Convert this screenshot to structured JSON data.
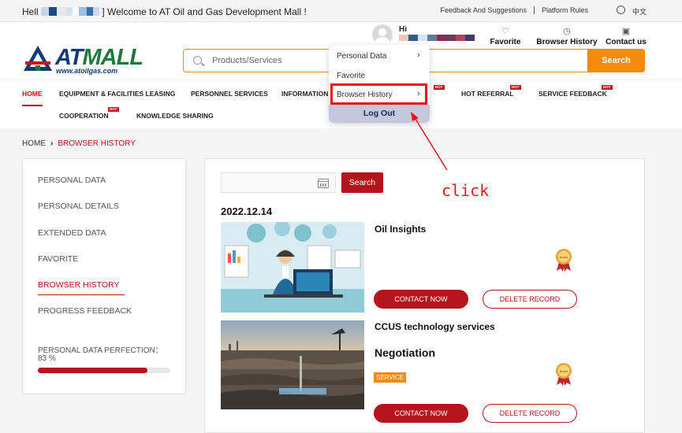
{
  "topbar": {
    "greeting_prefix": "Hell",
    "greeting_suffix": "] Welcome to AT Oil and Gas Development Mall !",
    "links": [
      "Feedback And Suggestions",
      "Platform Rules"
    ],
    "language": "中文"
  },
  "header": {
    "logo_text": "ATMALL",
    "logo_url": "www.atoilgas.com",
    "search_placeholder": "Products/Services",
    "search_button": "Search",
    "user_greeting": "Hi",
    "actions": [
      {
        "label": "Favorite",
        "icon": "heart-icon"
      },
      {
        "label": "Browser History",
        "icon": "clock-icon"
      },
      {
        "label": "Contact us",
        "icon": "chat-icon"
      }
    ]
  },
  "user_menu": {
    "items": [
      "Personal Data",
      "Favorite",
      "Browser History"
    ],
    "logout": "Log Out"
  },
  "nav": {
    "items": [
      "HOME",
      "EQUIPMENT & FACILITIES LEASING",
      "PERSONNEL SERVICES",
      "INFORMATION",
      "HOT REFERRAL",
      "SERVICE FEEDBACK",
      "COOPERATION",
      "KNOWLEDGE SHARING"
    ],
    "hot_badge": "HOT"
  },
  "breadcrumb": {
    "home": "HOME",
    "current": "BROWSER HISTORY"
  },
  "sidebar": {
    "items": [
      "PERSONAL DATA",
      "PERSONAL DETAILS",
      "EXTENDED DATA",
      "FAVORITE",
      "BROWSER HISTORY",
      "PROGRESS FEEDBACK"
    ],
    "active": "BROWSER HISTORY",
    "perfection_label": "PERSONAL DATA PERFECTION：",
    "perfection_value": "83 %",
    "perfection_fraction": 0.83
  },
  "main": {
    "search_button": "Search",
    "date": "2022.12.14",
    "records": [
      {
        "title": "Oil Insights",
        "contact": "CONTACT NOW",
        "delete": "DELETE RECORD",
        "badge": "Anton"
      },
      {
        "title": "CCUS technology services",
        "subtitle": "Negotiation",
        "tag": "SERVICE",
        "contact": "CONTACT NOW",
        "delete": "DELETE RECORD",
        "badge": "Anton"
      }
    ]
  },
  "annotation": {
    "text": "click"
  },
  "colors": {
    "brand_red": "#b3141d",
    "orange": "#f58b0c",
    "navy": "#0f3b7a",
    "green": "#1c7a3c"
  }
}
